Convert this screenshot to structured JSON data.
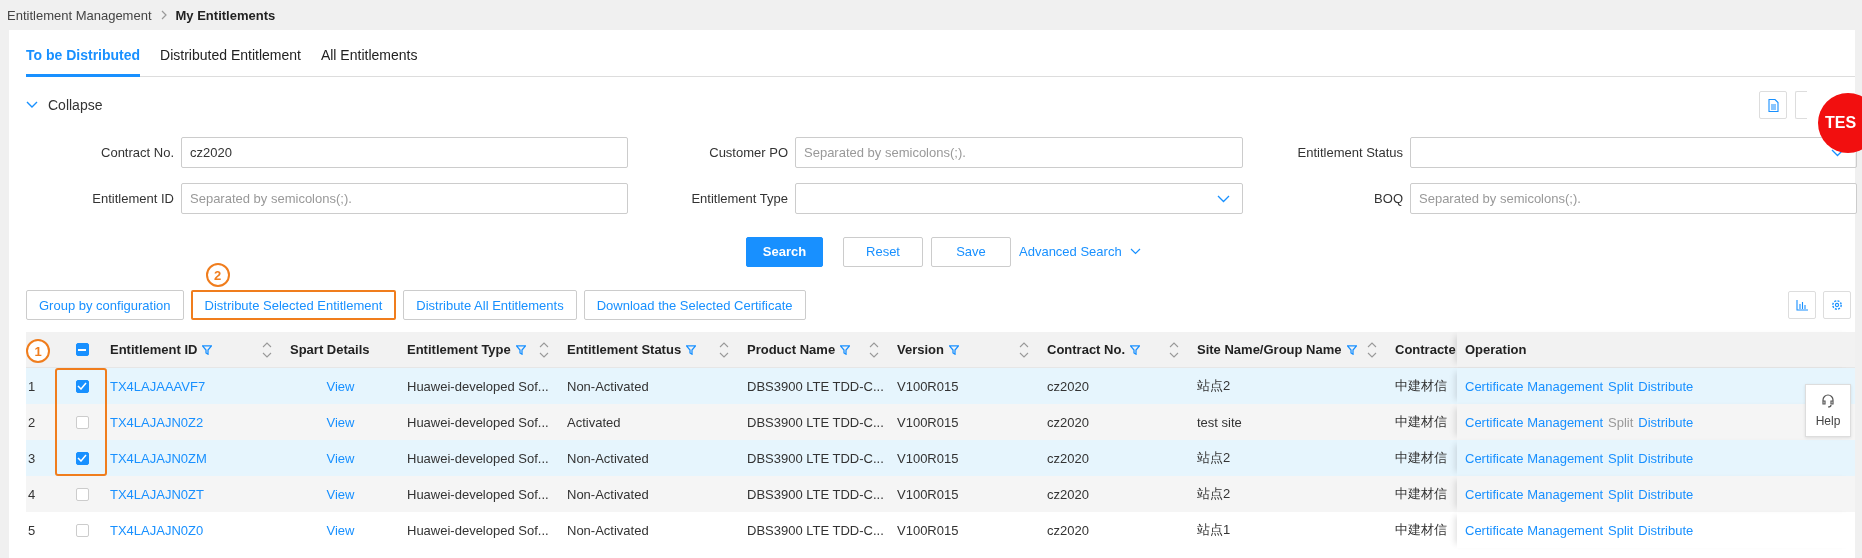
{
  "breadcrumb": [
    {
      "label": "Entitlement Management",
      "current": false
    },
    {
      "label": "My Entitlements",
      "current": true
    }
  ],
  "tabs": [
    {
      "label": "To be Distributed",
      "selected": true
    },
    {
      "label": "Distributed Entitlement",
      "selected": false
    },
    {
      "label": "All Entitlements",
      "selected": false
    }
  ],
  "collapse": {
    "label": "Collapse",
    "expanded": true
  },
  "badge": "TES",
  "filters": [
    {
      "label": "Contract No.",
      "kind": "text",
      "value": "cz2020"
    },
    {
      "label": "Customer PO",
      "kind": "text",
      "placeholder": "Separated by semicolons(;)."
    },
    {
      "label": "Entitlement Status",
      "kind": "select"
    },
    {
      "label": "Entitlement ID",
      "kind": "text",
      "placeholder": "Separated by semicolons(;)."
    },
    {
      "label": "Entitlement Type",
      "kind": "select"
    },
    {
      "label": "BOQ",
      "kind": "text",
      "placeholder": "Separated by semicolons(;)."
    }
  ],
  "search_buttons": [
    {
      "label": "Search",
      "kind": "primary"
    },
    {
      "label": "Reset",
      "kind": "default"
    },
    {
      "label": "Save",
      "kind": "default"
    },
    {
      "label": "Advanced Search",
      "kind": "link"
    }
  ],
  "actions": [
    {
      "label": "Group by configuration",
      "highlighted": false
    },
    {
      "label": "Distribute Selected Entitlement",
      "highlighted": true,
      "annotation": "2"
    },
    {
      "label": "Distribute All Entitlements",
      "highlighted": false
    },
    {
      "label": "Download the Selected Certificate",
      "highlighted": false
    }
  ],
  "table": {
    "annotation": "1",
    "header_checkbox": {
      "indeterminate": true
    },
    "columns": [
      {
        "label": "Entitlement ID",
        "kind": "link",
        "filter": true,
        "sort": true
      },
      {
        "label": "Spart Details",
        "kind": "center-link",
        "filter": false,
        "sort": false
      },
      {
        "label": "Entitlement Type",
        "kind": "text",
        "filter": true,
        "sort": true
      },
      {
        "label": "Entitlement Status",
        "kind": "text",
        "filter": true,
        "sort": true
      },
      {
        "label": "Product Name",
        "kind": "text",
        "filter": true,
        "sort": true
      },
      {
        "label": "Version",
        "kind": "text",
        "filter": true,
        "sort": true
      },
      {
        "label": "Contract No.",
        "kind": "text",
        "filter": true,
        "sort": true
      },
      {
        "label": "Site Name/Group Name",
        "kind": "text",
        "filter": true,
        "sort": true
      },
      {
        "label": "Contracte",
        "kind": "text",
        "filter": false,
        "sort": false
      }
    ],
    "operation_label": "Operation",
    "rows": [
      {
        "index": "1",
        "selected": true,
        "cells": [
          "TX4LAJAAAVF7",
          "View",
          "Huawei-developed Sof...",
          "Non-Activated",
          "DBS3900 LTE TDD-C...",
          "V100R015",
          "cz2020",
          "站点2",
          "中建材信"
        ],
        "operations": [
          {
            "label": "Certificate Management",
            "disabled": false
          },
          {
            "label": "Split",
            "disabled": false
          },
          {
            "label": "Distribute",
            "disabled": false
          }
        ]
      },
      {
        "index": "2",
        "selected": false,
        "cells": [
          "TX4LAJAJN0Z2",
          "View",
          "Huawei-developed Sof...",
          "Activated",
          "DBS3900 LTE TDD-C...",
          "V100R015",
          "cz2020",
          "test site",
          "中建材信"
        ],
        "operations": [
          {
            "label": "Certificate Management",
            "disabled": false
          },
          {
            "label": "Split",
            "disabled": true
          },
          {
            "label": "Distribute",
            "disabled": false
          }
        ]
      },
      {
        "index": "3",
        "selected": true,
        "cells": [
          "TX4LAJAJN0ZM",
          "View",
          "Huawei-developed Sof...",
          "Non-Activated",
          "DBS3900 LTE TDD-C...",
          "V100R015",
          "cz2020",
          "站点2",
          "中建材信"
        ],
        "operations": [
          {
            "label": "Certificate Management",
            "disabled": false
          },
          {
            "label": "Split",
            "disabled": false
          },
          {
            "label": "Distribute",
            "disabled": false
          }
        ]
      },
      {
        "index": "4",
        "selected": false,
        "cells": [
          "TX4LAJAJN0ZT",
          "View",
          "Huawei-developed Sof...",
          "Non-Activated",
          "DBS3900 LTE TDD-C...",
          "V100R015",
          "cz2020",
          "站点2",
          "中建材信"
        ],
        "operations": [
          {
            "label": "Certificate Management",
            "disabled": false
          },
          {
            "label": "Split",
            "disabled": false
          },
          {
            "label": "Distribute",
            "disabled": false
          }
        ]
      },
      {
        "index": "5",
        "selected": false,
        "cells": [
          "TX4LAJAJN0Z0",
          "View",
          "Huawei-developed Sof...",
          "Non-Activated",
          "DBS3900 LTE TDD-C...",
          "V100R015",
          "cz2020",
          "站点1",
          "中建材信"
        ],
        "operations": [
          {
            "label": "Certificate Management",
            "disabled": false
          },
          {
            "label": "Split",
            "disabled": false
          },
          {
            "label": "Distribute",
            "disabled": false
          }
        ]
      }
    ]
  },
  "help": {
    "label": "Help"
  }
}
